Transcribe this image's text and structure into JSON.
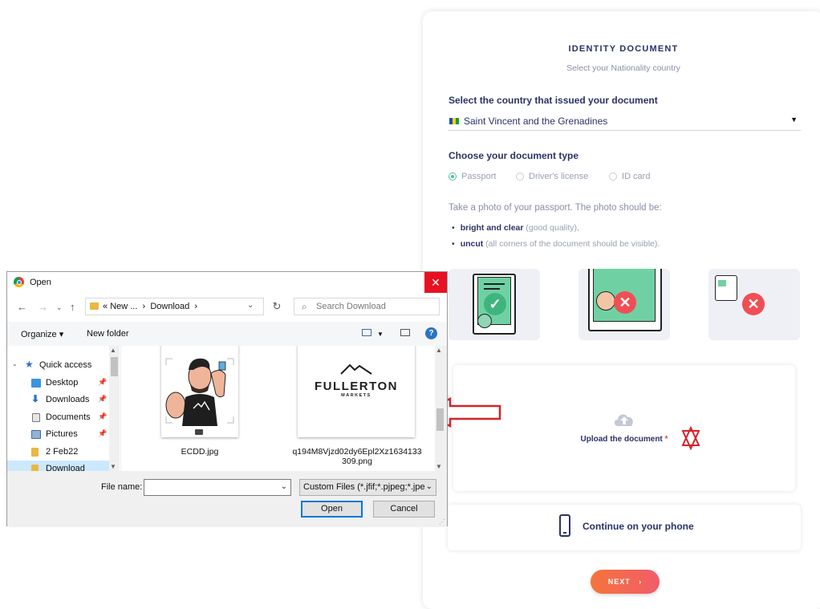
{
  "identity": {
    "title": "IDENTITY DOCUMENT",
    "subtitle": "Select your Nationality country",
    "country_label": "Select the country that issued your document",
    "country_value": "Saint Vincent and the Grenadines",
    "doc_type_label": "Choose your document type",
    "doc_types": [
      {
        "label": "Passport",
        "selected": true
      },
      {
        "label": "Driver's license",
        "selected": false
      },
      {
        "label": "ID card",
        "selected": false
      }
    ],
    "hint": "Take a photo of your passport. The photo should be:",
    "bullets": [
      {
        "strong": "bright and clear",
        "rest": " (good quality),"
      },
      {
        "strong": "uncut",
        "rest": " (all corners of the document should be visible)."
      }
    ],
    "upload_label": "Upload the document",
    "required_mark": "*",
    "phone_label": "Continue on your phone",
    "next_label": "NEXT",
    "next_arrow": "›",
    "colors": {
      "accent": "#2a3366",
      "ok": "#4cc29a",
      "error": "#f04e55",
      "next_from": "#f4743b",
      "next_to": "#f25c6a"
    }
  },
  "dialog": {
    "title": "Open",
    "close_glyph": "✕",
    "breadcrumb_prefix": "«",
    "breadcrumb": [
      "New ...",
      "Download"
    ],
    "search_placeholder": "Search Download",
    "organize_label": "Organize ▾",
    "new_folder_label": "New folder",
    "tree": [
      {
        "label": "Quick access",
        "icon": "star-icon",
        "pinned": false
      },
      {
        "label": "Desktop",
        "icon": "desktop-icon",
        "pinned": true
      },
      {
        "label": "Downloads",
        "icon": "download-icon",
        "pinned": true
      },
      {
        "label": "Documents",
        "icon": "documents-icon",
        "pinned": true
      },
      {
        "label": "Pictures",
        "icon": "pictures-icon",
        "pinned": true
      },
      {
        "label": "2 Feb22",
        "icon": "folder-icon",
        "pinned": false
      },
      {
        "label": "Download",
        "icon": "folder-icon",
        "pinned": false
      }
    ],
    "files": [
      {
        "name": "ECDD.jpg"
      },
      {
        "name_line1": "q194M8Vjzd02dy6Epl2Xz1634133",
        "name_line2": "309.png",
        "logo_text": "FULLERTON",
        "logo_sub": "MARKETS"
      }
    ],
    "file_name_label": "File name:",
    "file_name_value": "",
    "filter_value": "Custom Files (*.jfif;*.pjpeg;*.jpe",
    "open_label": "Open",
    "cancel_label": "Cancel"
  }
}
